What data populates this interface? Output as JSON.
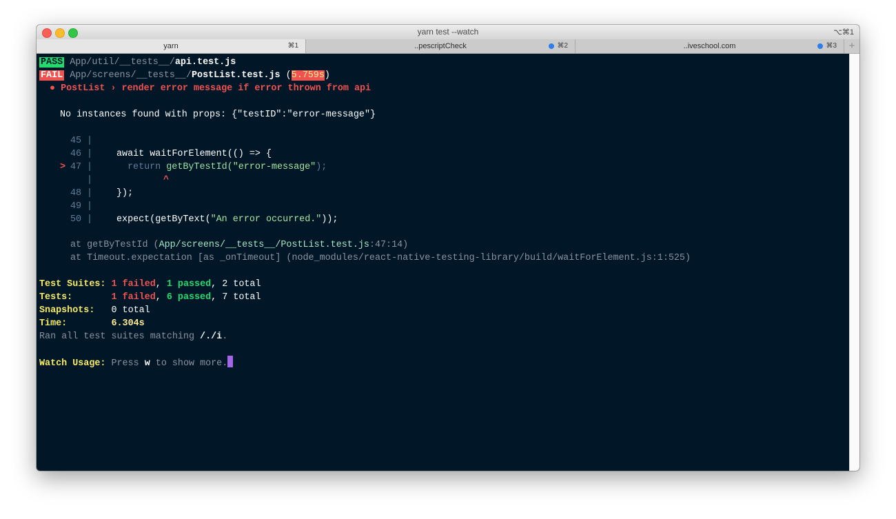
{
  "window": {
    "title": "yarn test --watch",
    "shortcut": "⌥⌘1",
    "tabs": [
      {
        "label": "yarn",
        "key": "⌘1",
        "active": true
      },
      {
        "label": "..pescriptCheck",
        "key": "⌘2",
        "active": false
      },
      {
        "label": "..iveschool.com",
        "key": "⌘3",
        "active": false
      }
    ],
    "new_tab": "+"
  },
  "colors": {
    "background": "#011627",
    "pass": "#22da6e",
    "fail": "#ef5350",
    "cursor": "#a167e5"
  },
  "terminal": {
    "pass_line": {
      "badge": "PASS",
      "path": "App/util/__tests__/",
      "file": "api.test.js"
    },
    "fail_line": {
      "badge": "FAIL",
      "path": "App/screens/__tests__/",
      "file": "PostList.test.js",
      "paren_open": " (",
      "time": "5.759s",
      "paren_close": ")"
    },
    "failed_test": "● PostList › render error message if error thrown from api",
    "error_message": "No instances found with props: {\"testID\":\"error-message\"}",
    "code": [
      {
        "num": "45",
        "marker": "",
        "code": ""
      },
      {
        "num": "46",
        "marker": "",
        "code": "await waitForElement(() => {"
      },
      {
        "num": "47",
        "marker": ">",
        "keyword": "return ",
        "call": "getByTestId(",
        "string": "\"error-message\"",
        "tail": ");"
      },
      {
        "num": "",
        "marker": "",
        "caret": "^"
      },
      {
        "num": "48",
        "marker": "",
        "code": "});"
      },
      {
        "num": "49",
        "marker": "",
        "code": ""
      },
      {
        "num": "50",
        "marker": "",
        "code_pre": "expect(getByText(",
        "string": "\"An error occurred.\"",
        "code_post": "));"
      }
    ],
    "stack": [
      {
        "prefix": "at getByTestId (",
        "path": "App/screens/__tests__/PostList.test.js",
        "loc": ":47:14)"
      },
      {
        "text": "at Timeout.expectation [as _onTimeout] (node_modules/react-native-testing-library/build/waitForElement.js:1:525)"
      }
    ],
    "summary": {
      "suites_label": "Test Suites:",
      "suites_failed": "1 failed",
      "suites_passed": "1 passed",
      "suites_total": ", 2 total",
      "tests_label": "Tests:",
      "tests_failed": "1 failed",
      "tests_passed": "6 passed",
      "tests_total": ", 7 total",
      "snapshots_label": "Snapshots:",
      "snapshots_value": "0 total",
      "time_label": "Time:",
      "time_value": "6.304s",
      "ran_prefix": "Ran all test suites matching ",
      "ran_pattern": "/./i",
      "ran_suffix": "."
    },
    "watch": {
      "label": "Watch Usage:",
      "pre": "Press ",
      "key": "w",
      "post": " to show more."
    }
  }
}
